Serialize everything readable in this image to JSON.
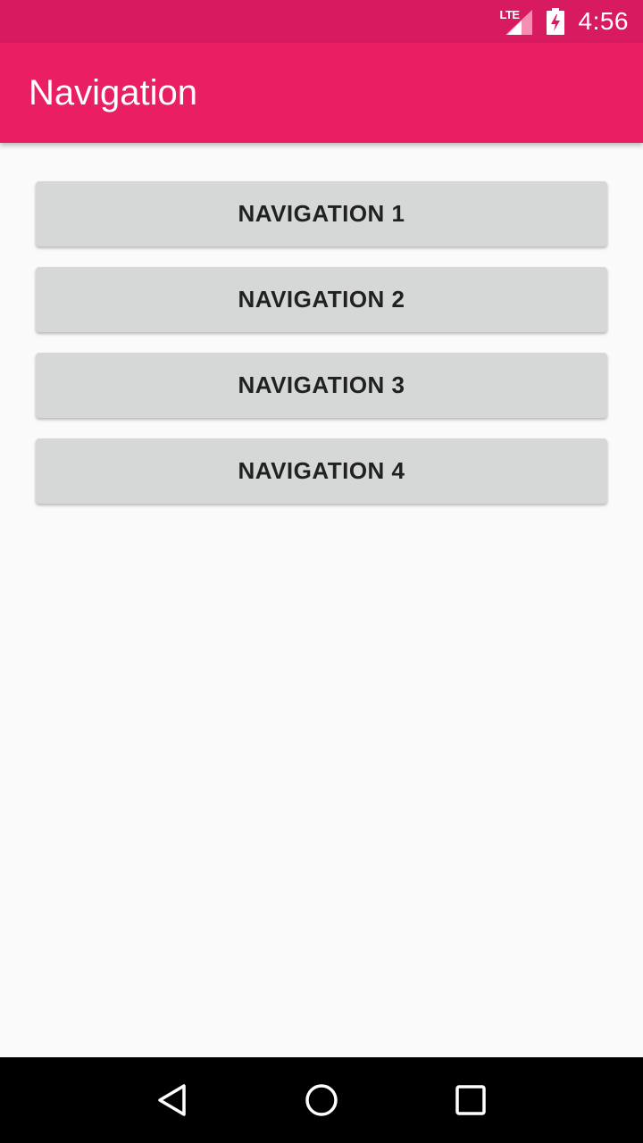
{
  "status_bar": {
    "network": "LTE",
    "time": "4:56",
    "icons": [
      "lte-signal-icon",
      "battery-charging-icon"
    ]
  },
  "app_bar": {
    "title": "Navigation"
  },
  "buttons": [
    {
      "label": "NAVIGATION 1"
    },
    {
      "label": "NAVIGATION 2"
    },
    {
      "label": "NAVIGATION 3"
    },
    {
      "label": "NAVIGATION 4"
    }
  ],
  "system_nav": {
    "icons": [
      "back-icon",
      "home-icon",
      "recents-icon"
    ]
  },
  "colors": {
    "status_bar": "#d81b60",
    "app_bar": "#e91e63",
    "button_bg": "#d6d7d7",
    "background": "#fafafa"
  }
}
